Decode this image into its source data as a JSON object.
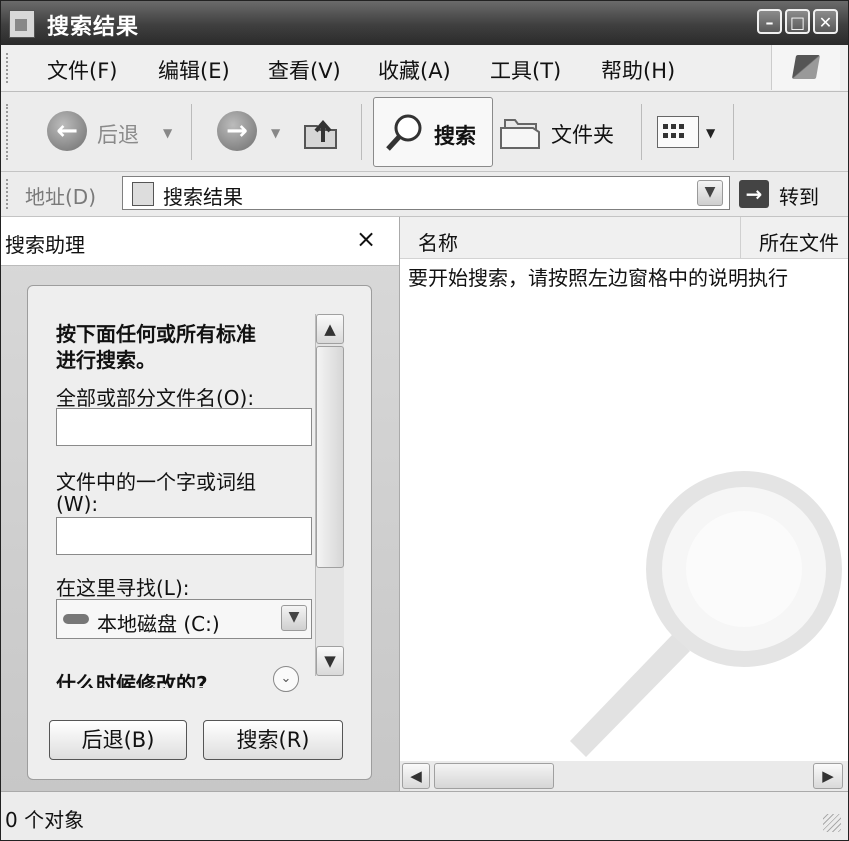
{
  "window": {
    "title": "搜索结果"
  },
  "menu": [
    "文件(F)",
    "编辑(E)",
    "查看(V)",
    "收藏(A)",
    "工具(T)",
    "帮助(H)"
  ],
  "toolbar": {
    "back_label": "后退",
    "search_label": "搜索",
    "folders_label": "文件夹"
  },
  "address": {
    "label": "地址(D)",
    "value": "搜索结果",
    "go_label": "转到"
  },
  "search_pane": {
    "title": "搜索助理",
    "close": "×",
    "heading_line1": "按下面任何或所有标准",
    "heading_line2": "进行搜索。",
    "filename_label": "全部或部分文件名(O):",
    "filename_value": "",
    "phrase_label_line1": "文件中的一个字或词组",
    "phrase_label_line2": "(W):",
    "phrase_value": "",
    "lookin_label": "在这里寻找(L):",
    "lookin_value": "本地磁盘 (C:)",
    "when_modified": "什么时候修改的?",
    "back_button": "后退(B)",
    "search_button": "搜索(R)"
  },
  "results": {
    "columns": [
      "名称",
      "所在文件"
    ],
    "message": "要开始搜索，请按照左边窗格中的说明执行"
  },
  "status": {
    "text": "0 个对象"
  }
}
